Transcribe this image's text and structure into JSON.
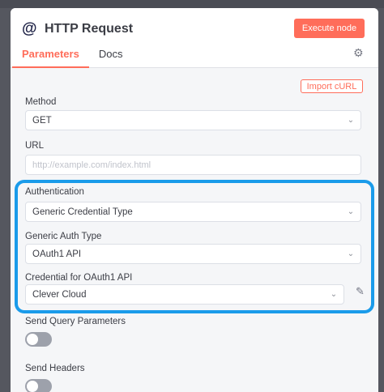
{
  "node": {
    "title": "HTTP Request",
    "execute_label": "Execute node"
  },
  "tabs": [
    {
      "label": "Parameters",
      "active": true
    },
    {
      "label": "Docs",
      "active": false
    }
  ],
  "import_label": "Import cURL",
  "fields": {
    "method": {
      "label": "Method",
      "value": "GET"
    },
    "url": {
      "label": "URL",
      "placeholder": "http://example.com/index.html"
    },
    "authentication": {
      "label": "Authentication",
      "value": "Generic Credential Type"
    },
    "generic_auth_type": {
      "label": "Generic Auth Type",
      "value": "OAuth1 API"
    },
    "credential": {
      "label": "Credential for OAuth1 API",
      "value": "Clever Cloud"
    },
    "send_query": {
      "label": "Send Query Parameters",
      "enabled": false
    },
    "send_headers": {
      "label": "Send Headers",
      "enabled": false
    }
  },
  "colors": {
    "accent": "#ff6d5a",
    "highlight": "#1a9bea"
  },
  "icons": [
    "at-icon",
    "gear-icon",
    "chevron-down-icon",
    "pencil-icon"
  ]
}
